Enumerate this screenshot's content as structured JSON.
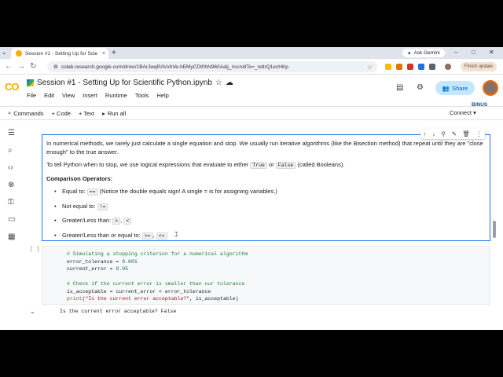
{
  "browser": {
    "tab_title": "Session #1 - Setting Up for Scie",
    "tab_close": "×",
    "new_tab": "+",
    "ask_gemini": "Ask Gemini",
    "url": "colab.research.google.com/drive/1BArJwqRAVxhVe-hEMyCDt0hN960Aatj_#scrollTo=_ndtrQ1ezHKp",
    "finish_update": "Finish update",
    "window_minimize": "–",
    "window_maximize": "□",
    "window_close": "✕"
  },
  "colab": {
    "logo": "CO",
    "notebook_title": "Session #1 - Setting Up for Scientific Python.ipynb",
    "menu": [
      "File",
      "Edit",
      "View",
      "Insert",
      "Runtime",
      "Tools",
      "Help"
    ],
    "share_label": "Share",
    "binus_badge": "BINUS"
  },
  "toolbar": {
    "commands": "Commands",
    "code": "+ Code",
    "text": "+ Text",
    "run_all": "Run all",
    "connect": "Connect"
  },
  "text_cell": {
    "para1": "In numerical methods, we rarely just calculate a single equation and stop. We usually run iterative algorithms (like the Bisection method) that repeat until they are \"close enough\" to the true answer.",
    "para2_prefix": "To tell Python when to stop, we use logical expressions that evaluate to either",
    "para2_true": "True",
    "para2_or": "or",
    "para2_false": "False",
    "para2_suffix": "(called Booleans).",
    "heading": "Comparison Operators:",
    "bullets": [
      {
        "label": "Equal to:",
        "code": "==",
        "note": "(Notice the double equals sign! A single = is for assigning variables.)"
      },
      {
        "label": "Not equal to:",
        "code": "!="
      },
      {
        "label": "Greater/Less than:",
        "code1": ">",
        "code2": "<"
      },
      {
        "label": "Greater/Less than or equal to:",
        "code1": ">=",
        "code2": "<="
      }
    ]
  },
  "code_cell": {
    "run_indicator": "[ ]",
    "lines": {
      "l1": "# Simulating a stopping criterion for a numerical algorithm",
      "l2_var": "error_tolerance",
      "l2_val": "0.001",
      "l3_var": "current_error",
      "l3_val": "0.05",
      "l5": "# Check if the current error is smaller than our tolerance",
      "l6": "is_acceptable = current_error < error_tolerance",
      "l7_fn": "print",
      "l7_str": "\"Is the current error acceptable?\"",
      "l7_rest": ", is_acceptable)"
    },
    "output": "Is the current error acceptable? False"
  },
  "colors": {
    "accent": "#1a73e8",
    "share_bg": "#c2e7ff",
    "colab_orange": "#f9ab00"
  }
}
